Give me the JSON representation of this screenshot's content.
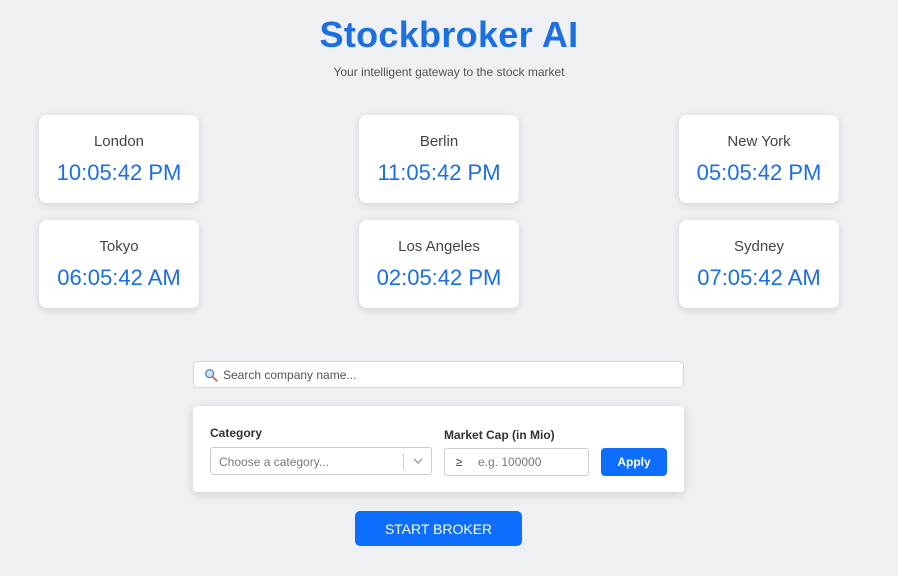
{
  "header": {
    "title": "Stockbroker AI",
    "subtitle": "Your intelligent gateway to the stock market"
  },
  "clocks": [
    {
      "city": "London",
      "time": "10:05:42 PM"
    },
    {
      "city": "Berlin",
      "time": "11:05:42 PM"
    },
    {
      "city": "New York",
      "time": "05:05:42 PM"
    },
    {
      "city": "Tokyo",
      "time": "06:05:42 AM"
    },
    {
      "city": "Los Angeles",
      "time": "02:05:42 PM"
    },
    {
      "city": "Sydney",
      "time": "07:05:42 AM"
    }
  ],
  "search": {
    "placeholder": "Search company name...",
    "value": "",
    "icon": "magnifier-icon"
  },
  "filters": {
    "category_label": "Category",
    "category_placeholder": "Choose a category...",
    "market_cap_label": "Market Cap (in Mio)",
    "market_cap_prefix": "≥",
    "market_cap_placeholder": "e.g. 100000",
    "market_cap_value": "",
    "apply_label": "Apply"
  },
  "actions": {
    "start_label": "START BROKER"
  },
  "colors": {
    "accent": "#1a6fe3",
    "button": "#0d6efd",
    "background": "#eef0f4"
  }
}
